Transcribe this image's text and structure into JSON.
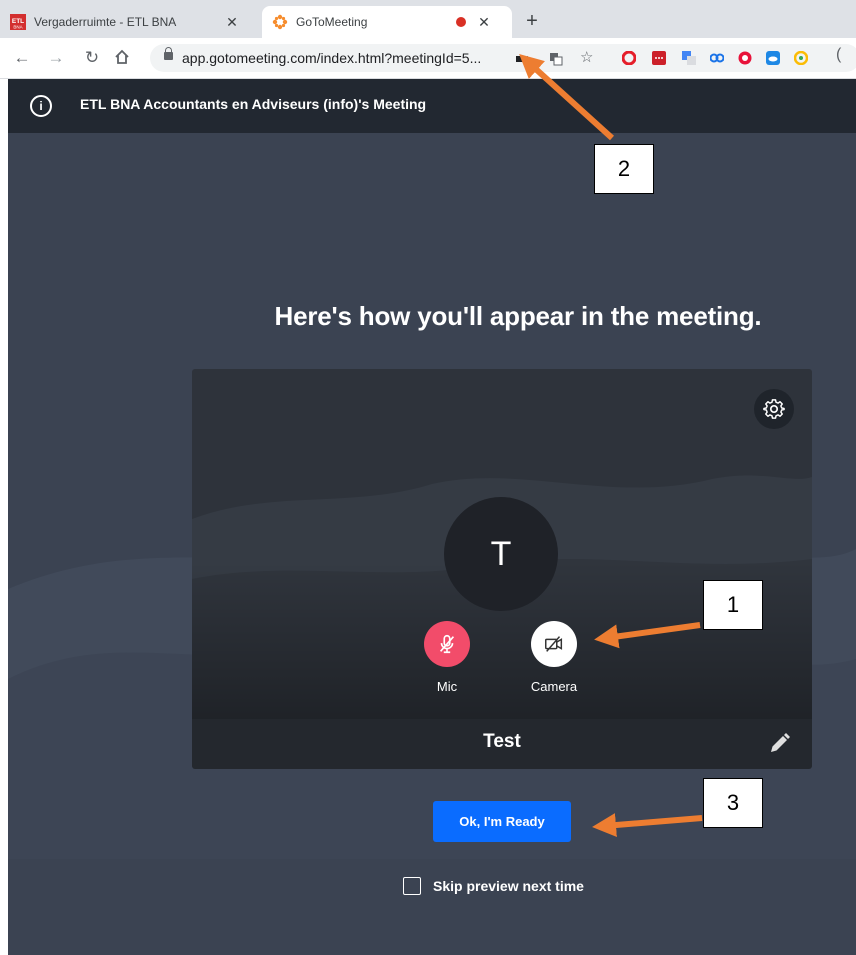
{
  "browser": {
    "tabs": [
      {
        "title": "Vergaderruimte - ETL BNA",
        "favicon": "etl-favicon"
      },
      {
        "title": "GoToMeeting",
        "favicon": "gotomeeting-favicon"
      }
    ],
    "url": "app.gotomeeting.com/index.html?meetingId=5...",
    "favicon_text": "ETL"
  },
  "app": {
    "meeting_title": "ETL BNA Accountants en Adviseurs (info)'s Meeting",
    "headline": "Here's how you'll appear in the meeting.",
    "avatar_initial": "T",
    "mic_label": "Mic",
    "camera_label": "Camera",
    "display_name": "Test",
    "ready_button": "Ok, I'm Ready",
    "skip_label": "Skip preview next time",
    "skip_checked": false,
    "colors": {
      "header_bg": "#222831",
      "page_bg": "#3b4352",
      "mic_muted": "#f24c6a",
      "primary_button": "#0a6cff",
      "arrow": "#ed7d31"
    }
  },
  "annotations": {
    "callout_1": "1",
    "callout_2": "2",
    "callout_3": "3"
  }
}
